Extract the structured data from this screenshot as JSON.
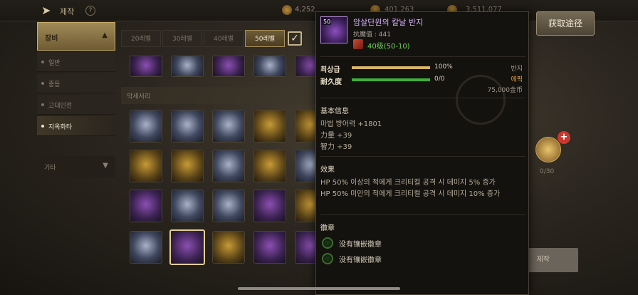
{
  "header": {
    "title": "제작",
    "help": "?",
    "resources": [
      "4,252",
      "401,263",
      "3,511,077"
    ]
  },
  "menu": {
    "category": "장비",
    "items": [
      {
        "label": "일반",
        "active": false
      },
      {
        "label": "중등",
        "active": false
      },
      {
        "label": "고대인전",
        "active": false
      },
      {
        "label": "지옥화타",
        "active": true
      }
    ],
    "more": "기타"
  },
  "tabs": [
    {
      "label": "20레벨",
      "selected": false
    },
    {
      "label": "30레벨",
      "selected": false
    },
    {
      "label": "40레벨",
      "selected": false
    },
    {
      "label": "50레벨",
      "selected": true
    }
  ],
  "section_label": "악세서리",
  "tooltip": {
    "icon_level": "50",
    "name": "암살단원의 칼날 반지",
    "magic_resist": "抗魔值 : 441",
    "level_range": "40级(50-10)",
    "quality_label": "최상급",
    "quality_percent": 100,
    "quality_value": "100%",
    "durability_label": "耐久度",
    "durability_value": "0/0",
    "durability_fraction": 1,
    "item_type": "반지",
    "grade": "에픽",
    "price": "75,000金币",
    "basic_title": "基本信息",
    "basic_lines": [
      "마법 방어력 +1801",
      "力量 +39",
      "智力 +39"
    ],
    "effect_title": "效果",
    "effect_lines": [
      "HP 50% 이상의 적에게 크리티컬 공격 시 데미지 5% 증가",
      "HP 50% 미만의 적에게 크리티컬 공격 시 데미지 10% 증가"
    ],
    "emblem_title": "徽章",
    "emblems": [
      "没有镶嵌徽章",
      "没有镶嵌徽章"
    ]
  },
  "acquire_button": "获取途径",
  "slot_count": "0/30",
  "make_button": "제작",
  "colors": {
    "epic": "#e0a13c",
    "level_ok": "#6fd25c",
    "item_name": "#d9b4ff",
    "quality_bar": "#d8b56a",
    "durability_bar": "#3fae3a"
  }
}
